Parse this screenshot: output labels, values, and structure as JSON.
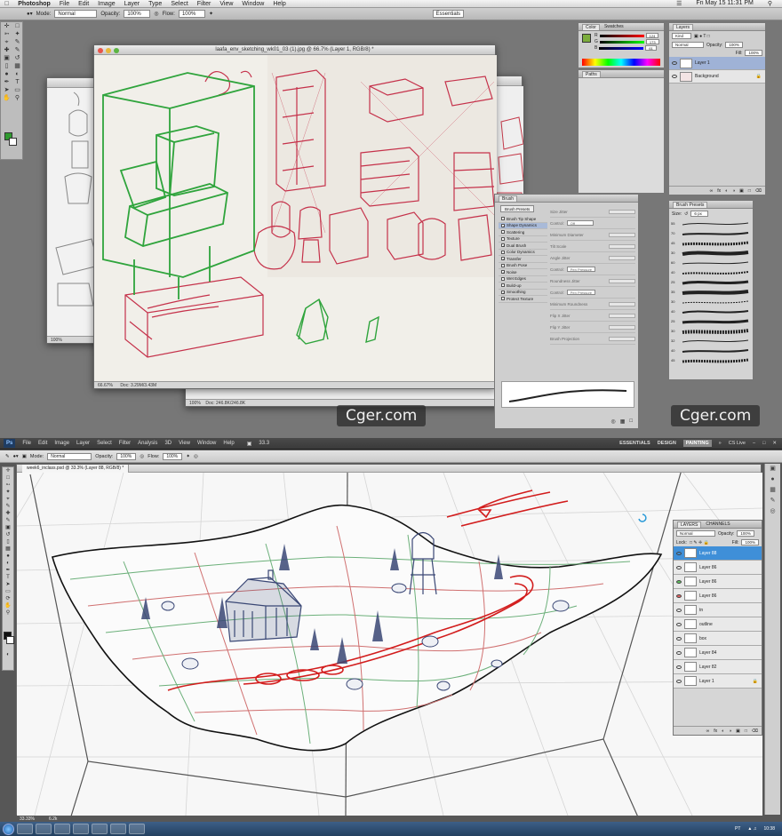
{
  "top": {
    "menubar": {
      "app": "Photoshop",
      "items": [
        "File",
        "Edit",
        "Image",
        "Layer",
        "Type",
        "Select",
        "Filter",
        "View",
        "Window",
        "Help"
      ],
      "clock": "Fri May 15  11:31 PM"
    },
    "options": {
      "mode_label": "Mode:",
      "mode_value": "Normal",
      "opacity_label": "Opacity:",
      "opacity_value": "100%",
      "flow_label": "Flow:",
      "flow_value": "100%",
      "workspace": "Essentials"
    },
    "back_window": {
      "zoom": "100%"
    },
    "main_window": {
      "title": "laafa_env_sketching_wk01_03 (1).jpg @ 66.7% (Layer 1, RGB/8) *",
      "zoom": "66.67%",
      "doc": "Doc: 3.29M/3.43M"
    },
    "window2": {
      "zoom": "100%",
      "doc": "Doc: 246.8K/246.8K"
    },
    "color_panel": {
      "tabs": [
        "Color",
        "Swatches"
      ],
      "r": "124",
      "g": "173",
      "b": "61",
      "r_label": "R",
      "g_label": "G",
      "b_label": "B"
    },
    "paths_panel": {
      "title": "Paths"
    },
    "layers_panel": {
      "title": "Layers",
      "kind": "Kind",
      "blend": "Normal",
      "opacity_label": "Opacity:",
      "opacity": "100%",
      "fill_label": "Fill:",
      "fill": "100%",
      "layers": [
        "Layer 1",
        "Background"
      ]
    },
    "brush_panel": {
      "title": "Brush",
      "presets_button": "Brush Presets",
      "options": [
        "Brush Tip Shape",
        "Shape Dynamics",
        "Scattering",
        "Texture",
        "Dual Brush",
        "Color Dynamics",
        "Transfer",
        "Brush Pose",
        "Noise",
        "Wet Edges",
        "Build-up",
        "Smoothing",
        "Protect Texture"
      ],
      "checked": [
        false,
        true,
        false,
        false,
        true,
        false,
        true,
        false,
        true,
        false,
        false,
        true,
        false
      ],
      "right_labels": [
        "Size Jitter",
        "Control:",
        "Minimum Diameter",
        "Tilt Scale",
        "Angle Jitter",
        "Control:",
        "Roundness Jitter",
        "Control:",
        "Minimum Roundness",
        "Flip X Jitter",
        "Flip Y Jitter",
        "Brush Projection"
      ],
      "control_values": [
        "Off",
        "Pen Pressure",
        "Pen Pressure"
      ]
    },
    "brush_presets": {
      "title": "Brush Presets",
      "size_label": "Size:",
      "size_value": "6 px",
      "sizes": [
        "55",
        "70",
        "45",
        "30",
        "60",
        "40",
        "25",
        "35",
        "30",
        "40",
        "25",
        "30",
        "32",
        "40",
        "45"
      ]
    },
    "watermark": "Cger.com"
  },
  "bottom": {
    "menubar": {
      "logo": "Ps",
      "items": [
        "File",
        "Edit",
        "Image",
        "Layer",
        "Select",
        "Filter",
        "Analysis",
        "3D",
        "View",
        "Window",
        "Help"
      ],
      "zoom": "33.3",
      "workspaces": [
        "ESSENTIALS",
        "DESIGN",
        "PAINTING"
      ],
      "active_workspace": "PAINTING",
      "cs_live": "CS Live"
    },
    "options": {
      "mode_label": "Mode:",
      "mode_value": "Normal",
      "opacity_label": "Opacity:",
      "opacity_value": "100%",
      "flow_label": "Flow:",
      "flow_value": "100%"
    },
    "doc_tab": "week6_inclass.psd @ 33.3% (Layer 88, RGB/8) *",
    "status": {
      "zoom": "33.33%",
      "doc": "6.2k"
    },
    "layers_panel": {
      "tabs": [
        "LAYERS",
        "CHANNELS"
      ],
      "blend": "Normal",
      "opacity_label": "Opacity:",
      "opacity": "100%",
      "lock_label": "Lock:",
      "fill_label": "Fill:",
      "fill": "100%",
      "layers": [
        {
          "name": "Layer 88",
          "tag": ""
        },
        {
          "name": "Layer 86",
          "tag": ""
        },
        {
          "name": "Layer 86",
          "tag": "#5cc05c"
        },
        {
          "name": "Layer 86",
          "tag": "#e06060"
        },
        {
          "name": "tn",
          "tag": ""
        },
        {
          "name": "outline",
          "tag": ""
        },
        {
          "name": "box",
          "tag": ""
        },
        {
          "name": "Layer 84",
          "tag": ""
        },
        {
          "name": "Layer 82",
          "tag": ""
        },
        {
          "name": "Layer 1",
          "tag": ""
        }
      ]
    },
    "taskbar": {
      "clock": "10:38",
      "lang": "PT"
    }
  }
}
